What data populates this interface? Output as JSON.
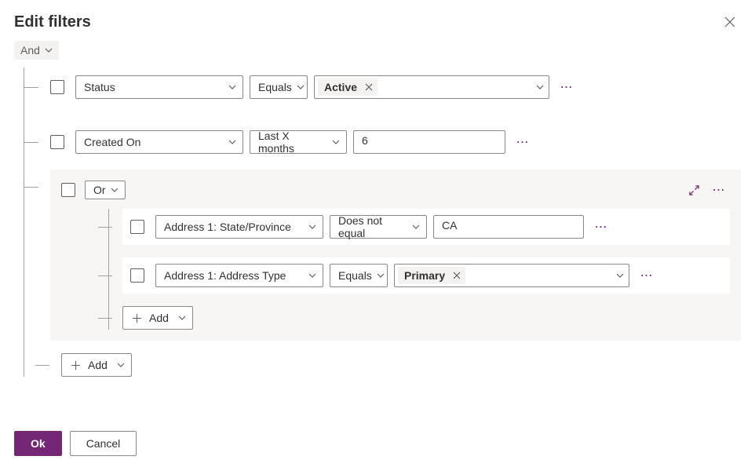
{
  "dialog": {
    "title": "Edit filters"
  },
  "rootGroup": {
    "operator": "And"
  },
  "rows": [
    {
      "field": "Status",
      "operator": "Equals",
      "valueTag": "Active"
    },
    {
      "field": "Created On",
      "operator": "Last X months",
      "valueText": "6"
    }
  ],
  "subgroup": {
    "operator": "Or",
    "rows": [
      {
        "field": "Address 1: State/Province",
        "operator": "Does not equal",
        "valueText": "CA"
      },
      {
        "field": "Address 1: Address Type",
        "operator": "Equals",
        "valueTag": "Primary"
      }
    ],
    "addLabel": "Add"
  },
  "outerAddLabel": "Add",
  "buttons": {
    "ok": "Ok",
    "cancel": "Cancel"
  }
}
